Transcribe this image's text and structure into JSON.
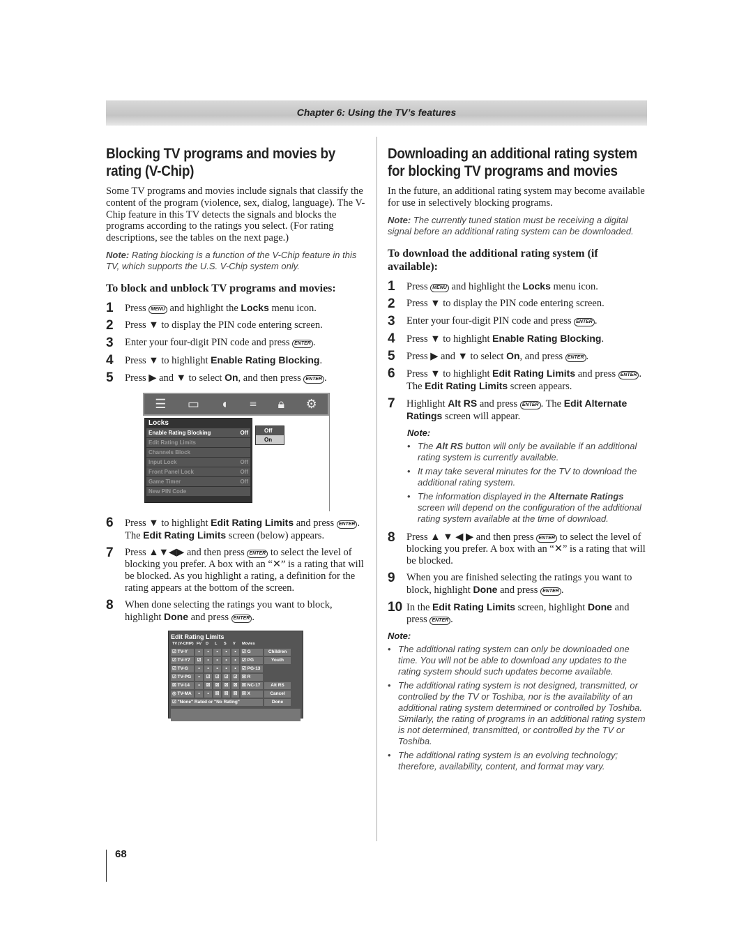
{
  "header": {
    "chapter": "Chapter 6: Using the TV’s features"
  },
  "left": {
    "title": "Blocking TV programs and movies by rating (V-Chip)",
    "intro": "Some TV programs and movies include signals that classify the content of the program (violence, sex, dialog, language). The V-Chip feature in this TV detects the signals and blocks the programs according to the ratings you select. (For rating descriptions, see the tables on the next page.)",
    "note_label": "Note:",
    "note": " Rating blocking is a function of the V-Chip feature in this TV, which supports the U.S. V-Chip system only.",
    "subheading": "To block and unblock TV programs and movies:",
    "steps_a": [
      {
        "n": "1",
        "segs": [
          "Press ",
          {
            "i": "MENU"
          },
          " and highlight the ",
          {
            "b": "Locks"
          },
          " menu icon."
        ]
      },
      {
        "n": "2",
        "segs": [
          "Press ▼ to display the PIN code entering screen."
        ]
      },
      {
        "n": "3",
        "segs": [
          "Enter your four-digit PIN code and press ",
          {
            "i": "ENTER"
          },
          "."
        ]
      },
      {
        "n": "4",
        "segs": [
          "Press ▼ to highlight ",
          {
            "b": "Enable Rating Blocking"
          },
          "."
        ]
      },
      {
        "n": "5",
        "segs": [
          "Press ▶ and ▼ to select ",
          {
            "b": "On"
          },
          ", and then press ",
          {
            "i": "ENTER"
          },
          "."
        ]
      }
    ],
    "locks_menu": {
      "title": "Locks",
      "icons": [
        "setup-icon",
        "picture-icon",
        "audio-icon",
        "preferences-icon",
        "lock-icon",
        "options-icon"
      ],
      "rows": [
        {
          "label": "Enable Rating Blocking",
          "value": "Off"
        },
        {
          "label": "Edit Rating Limits",
          "value": ""
        },
        {
          "label": "Channels Block",
          "value": ""
        },
        {
          "label": "Input Lock",
          "value": "Off"
        },
        {
          "label": "Front Panel Lock",
          "value": "Off"
        },
        {
          "label": "Game Timer",
          "value": "Off"
        },
        {
          "label": "New PIN Code",
          "value": ""
        }
      ],
      "popup": [
        "Off",
        "On"
      ],
      "popup_selected": "On"
    },
    "steps_b": [
      {
        "n": "6",
        "segs": [
          "Press ▼ to highlight ",
          {
            "b": "Edit Rating Limits"
          },
          " and press ",
          {
            "i": "ENTER"
          },
          ". The ",
          {
            "b": "Edit Rating Limits"
          },
          " screen (below) appears."
        ]
      },
      {
        "n": "7",
        "segs": [
          "Press ▲▼◀▶ and then press ",
          {
            "i": "ENTER"
          },
          " to select the level of blocking you prefer. A box with an “✕” is a rating that will be blocked. As you highlight a rating, a definition for the rating appears at the bottom of the screen."
        ]
      },
      {
        "n": "8",
        "segs": [
          "When done selecting the ratings you want to block, highlight ",
          {
            "b": "Done"
          },
          " and press ",
          {
            "i": "ENTER"
          },
          "."
        ]
      }
    ],
    "edit_rating": {
      "title": "Edit Rating Limits",
      "headers": [
        "TV (V-CHIP)",
        "FV",
        "D",
        "L",
        "S",
        "V",
        "Movies"
      ],
      "rows": [
        {
          "tv": "TV-Y",
          "tvs": "☑",
          "c": [
            "•",
            "•",
            "•",
            "•",
            "•"
          ],
          "movie": "G",
          "ms": "☑",
          "btn": "Children"
        },
        {
          "tv": "TV-Y7",
          "tvs": "☑",
          "c": [
            "☑",
            "•",
            "•",
            "•",
            "•"
          ],
          "movie": "PG",
          "ms": "☑",
          "btn": "Youth"
        },
        {
          "tv": "TV-G",
          "tvs": "☑",
          "c": [
            "•",
            "•",
            "•",
            "•",
            "•"
          ],
          "movie": "PG-13",
          "ms": "☑",
          "btn": ""
        },
        {
          "tv": "TV-PG",
          "tvs": "☑",
          "c": [
            "•",
            "☑",
            "☑",
            "☑",
            "☑"
          ],
          "movie": "R",
          "ms": "☒",
          "btn": ""
        },
        {
          "tv": "TV-14",
          "tvs": "☒",
          "c": [
            "•",
            "☒",
            "☒",
            "☒",
            "☒"
          ],
          "movie": "NC-17",
          "ms": "☒",
          "btn": "Alt RS"
        },
        {
          "tv": "TV-MA",
          "tvs": "◎",
          "c": [
            "•",
            "•",
            "☒",
            "☒",
            "☒"
          ],
          "movie": "X",
          "ms": "☒",
          "btn": "Cancel"
        }
      ],
      "none_rated": "☑ \"None\" Rated or \"No Rating\"",
      "done": "Done"
    }
  },
  "right": {
    "title": "Downloading an additional rating system for blocking TV programs and movies",
    "intro": "In the future, an additional rating system may become available for use in selectively blocking programs.",
    "note_label": "Note:",
    "note": " The currently tuned station must be receiving a digital signal before an additional rating system can be downloaded.",
    "subheading": "To download the additional rating system (if available):",
    "steps_a": [
      {
        "n": "1",
        "segs": [
          "Press ",
          {
            "i": "MENU"
          },
          " and highlight the ",
          {
            "b": "Locks"
          },
          " menu icon."
        ]
      },
      {
        "n": "2",
        "segs": [
          "Press ▼ to display the PIN code entering screen."
        ]
      },
      {
        "n": "3",
        "segs": [
          "Enter your four-digit PIN code and press ",
          {
            "i": "ENTER"
          },
          "."
        ]
      },
      {
        "n": "4",
        "segs": [
          "Press ▼ to highlight ",
          {
            "b": "Enable Rating Blocking"
          },
          "."
        ]
      },
      {
        "n": "5",
        "segs": [
          "Press ▶ and ▼ to select ",
          {
            "b": "On"
          },
          ", and press ",
          {
            "i": "ENTER"
          },
          "."
        ]
      },
      {
        "n": "6",
        "segs": [
          "Press ▼ to highlight ",
          {
            "b": "Edit Rating Limits"
          },
          " and press ",
          {
            "i": "ENTER"
          },
          ". The ",
          {
            "b": "Edit Rating Limits"
          },
          " screen appears."
        ]
      },
      {
        "n": "7",
        "segs": [
          "Highlight ",
          {
            "b": "Alt RS"
          },
          " and press ",
          {
            "i": "ENTER"
          },
          ". The ",
          {
            "b": "Edit Alternate Ratings"
          },
          " screen will appear."
        ]
      }
    ],
    "step_note_label": "Note:",
    "step_note_items": [
      [
        "The ",
        {
          "b": "Alt RS"
        },
        " button will only be available if an additional rating system is currently available."
      ],
      [
        "It may take several minutes for the TV to download the additional rating system."
      ],
      [
        "The information displayed in the ",
        {
          "b": "Alternate Ratings"
        },
        " screen will depend on the configuration of the additional rating system available at the time of download."
      ]
    ],
    "steps_b": [
      {
        "n": "8",
        "segs": [
          "Press ▲ ▼ ◀ ▶ and then press ",
          {
            "i": "ENTER"
          },
          " to select the level of blocking you prefer. A box with an “✕” is a rating that will be blocked."
        ]
      },
      {
        "n": "9",
        "segs": [
          "When you are finished selecting the ratings you want to block, highlight ",
          {
            "b": "Done"
          },
          " and press ",
          {
            "i": "ENTER"
          },
          "."
        ]
      },
      {
        "n": "10",
        "segs": [
          "In the ",
          {
            "b": "Edit Rating Limits"
          },
          " screen, highlight ",
          {
            "b": "Done"
          },
          " and press ",
          {
            "i": "ENTER"
          },
          "."
        ]
      }
    ],
    "final_note_label": "Note:",
    "final_note_items": [
      [
        "The additional rating system can only be downloaded one time. You will not be able to download any updates to the rating system should such updates become available."
      ],
      [
        "The additional rating system is not designed, transmitted, or controlled by the TV or Toshiba, nor is the availability of an additional rating system determined or controlled by Toshiba. Similarly, the rating of programs in an additional rating system is not determined, transmitted, or controlled by the TV or Toshiba."
      ],
      [
        "The additional rating system is an evolving technology; therefore, availability, content, and format may vary."
      ]
    ]
  },
  "page_number": "68"
}
